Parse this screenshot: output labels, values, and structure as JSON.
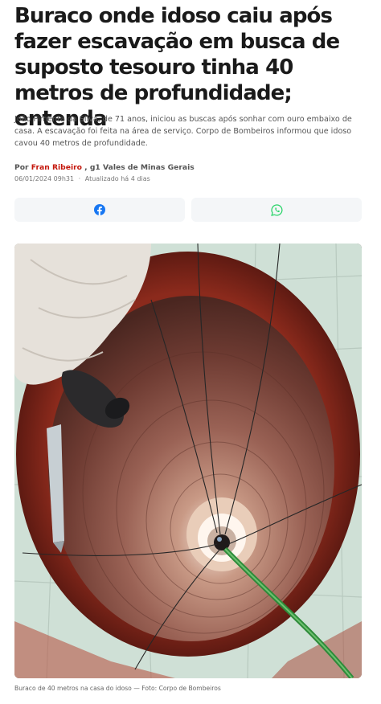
{
  "article": {
    "headline": "Buraco onde idoso caiu após fazer escavação em busca de suposto tesouro tinha 40 metros de profundidade; entenda",
    "subhead": "João Pimenta da Silva, de 71 anos, iniciou as buscas após sonhar com ouro embaixo de casa. A escavação foi feita na área de serviço. Corpo de Bombeiros informou que idoso cavou 40 metros de profundidade.",
    "byline": {
      "prefix": "Por",
      "author": "Fran Ribeiro",
      "outlet": ", g1 Vales de Minas Gerais"
    },
    "published": "06/01/2024 09h31",
    "separator": "·",
    "updated": "Atualizado há 4 dias"
  },
  "share": {
    "facebook_icon": "facebook-icon",
    "whatsapp_icon": "whatsapp-icon",
    "facebook_color": "#1877f2",
    "whatsapp_color": "#25d366"
  },
  "photo": {
    "caption": "Buraco de 40 metros na casa do idoso — Foto: Corpo de Bombeiros"
  },
  "colors": {
    "author_link": "#c4170c",
    "button_bg": "#f4f6f8"
  }
}
